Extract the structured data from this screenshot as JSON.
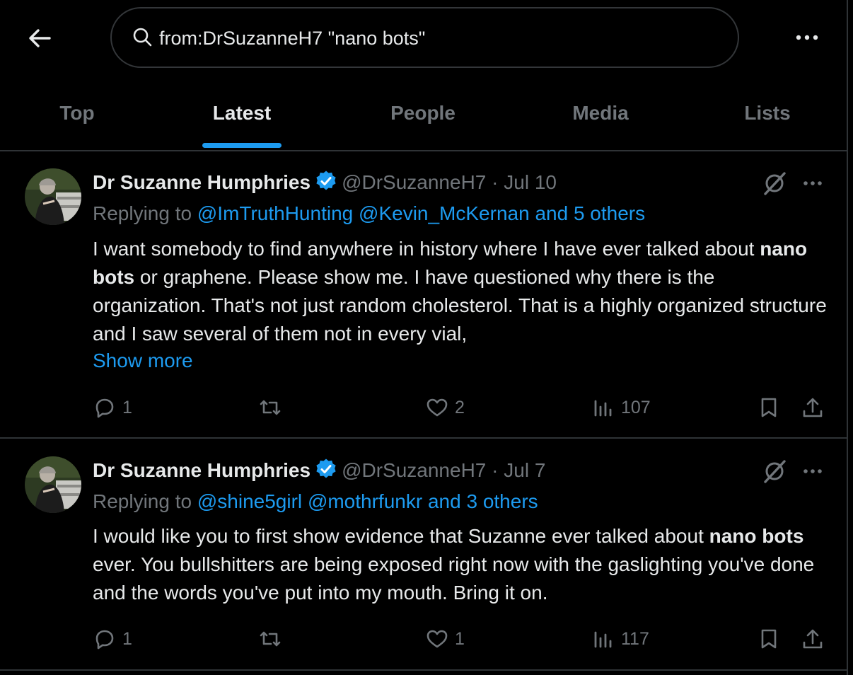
{
  "search": {
    "query": "from:DrSuzanneH7 \"nano bots\""
  },
  "tabs": [
    {
      "label": "Top"
    },
    {
      "label": "Latest"
    },
    {
      "label": "People"
    },
    {
      "label": "Media"
    },
    {
      "label": "Lists"
    }
  ],
  "active_tab": "Latest",
  "colors": {
    "accent": "#1d9bf0",
    "text": "#e7e9ea",
    "muted": "#71767b",
    "divider": "#2f3336",
    "background": "#000000"
  },
  "tweets": [
    {
      "name": "Dr Suzanne Humphries",
      "handle": "@DrSuzanneH7",
      "dot": "·",
      "date": "Jul 10",
      "replying_prefix": "Replying to",
      "replying_to": [
        "@ImTruthHunting",
        "@Kevin_McKernan",
        "and 5 others"
      ],
      "body_parts": [
        "I want somebody to find anywhere in history where I have ever talked about ",
        "nano bots",
        " or graphene. Please show me. I have questioned why there is the organization. That's not just random cholesterol. That is a highly organized structure and I saw several of them not in every vial,"
      ],
      "show_more": "Show more",
      "replies": "1",
      "reposts": "",
      "likes": "2",
      "views": "107"
    },
    {
      "name": "Dr Suzanne Humphries",
      "handle": "@DrSuzanneH7",
      "dot": "·",
      "date": "Jul 7",
      "replying_prefix": "Replying to",
      "replying_to": [
        "@shine5girl",
        "@mothrfunkr",
        "and 3 others"
      ],
      "body_parts": [
        "I would like you to first show evidence that Suzanne ever talked about ",
        "nano bots",
        " ever. You bullshitters are being exposed right now with the gaslighting you've done and the words you've put into my mouth. Bring it on."
      ],
      "replies": "1",
      "reposts": "",
      "likes": "1",
      "views": "117"
    }
  ],
  "icons": [
    "back-arrow-icon",
    "search-icon",
    "more-icon",
    "verified-badge-icon",
    "grok-icon",
    "reply-icon",
    "repost-icon",
    "like-icon",
    "views-icon",
    "bookmark-icon",
    "share-icon"
  ]
}
